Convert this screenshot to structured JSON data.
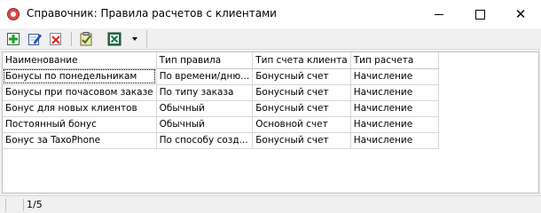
{
  "window": {
    "title": "Справочник: Правила расчетов с клиентами"
  },
  "toolbar": {
    "buttons": [
      {
        "name": "add-icon",
        "color": "#1f9e2a"
      },
      {
        "name": "edit-icon",
        "color": "#2a5bd6"
      },
      {
        "name": "delete-icon",
        "color": "#d62a2a"
      },
      {
        "name": "properties-icon",
        "color": "#2e7d32"
      },
      {
        "name": "excel-export-icon",
        "color": "#1e7145"
      }
    ]
  },
  "table": {
    "columns": [
      "Наименование",
      "Тип правила",
      "Тип счета клиента",
      "Тип расчета"
    ],
    "rows": [
      [
        "Бонусы по понедельникам",
        "По времени/дню...",
        "Бонусный счет",
        "Начисление"
      ],
      [
        "Бонусы при почасовом заказе",
        "По типу заказа",
        "Бонусный счет",
        "Начисление"
      ],
      [
        "Бонус для новых клиентов",
        "Обычный",
        "Бонусный счет",
        "Начисление"
      ],
      [
        "Постоянный бонус",
        "Обычный",
        "Основной счет",
        "Начисление"
      ],
      [
        "Бонус за TaxoPhone",
        "По способу созд...",
        "Бонусный счет",
        "Начисление"
      ]
    ],
    "selected_row": 0
  },
  "status": {
    "record_counter": "1/5"
  }
}
